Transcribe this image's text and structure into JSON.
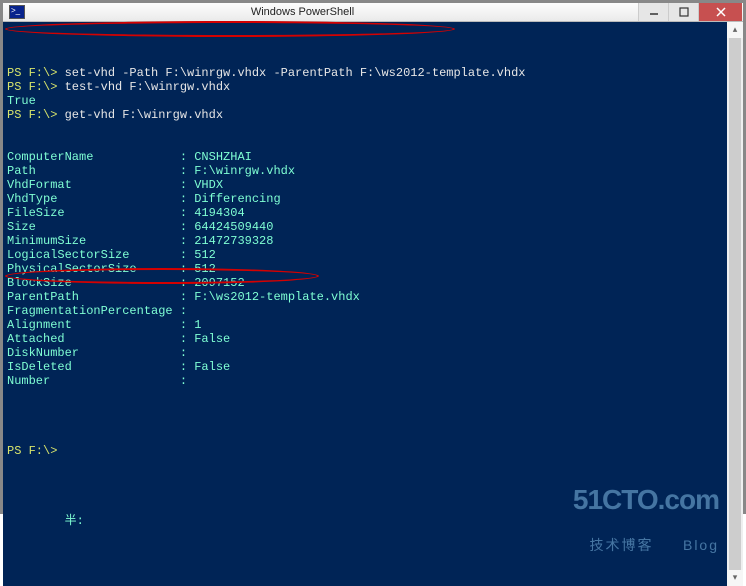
{
  "window": {
    "title": "Windows PowerShell"
  },
  "commands": {
    "prompt": "PS F:\\> ",
    "cmd1": "set-vhd -Path F:\\winrgw.vhdx -ParentPath F:\\ws2012-template.vhdx",
    "cmd2": "test-vhd F:\\winrgw.vhdx",
    "result2": "True",
    "cmd3": "get-vhd F:\\winrgw.vhdx",
    "final_prompt": "PS F:\\> ",
    "cursor_line": "        半:"
  },
  "vhd": [
    {
      "k": "ComputerName",
      "v": "CNSHZHAI"
    },
    {
      "k": "Path",
      "v": "F:\\winrgw.vhdx"
    },
    {
      "k": "VhdFormat",
      "v": "VHDX"
    },
    {
      "k": "VhdType",
      "v": "Differencing"
    },
    {
      "k": "FileSize",
      "v": "4194304"
    },
    {
      "k": "Size",
      "v": "64424509440"
    },
    {
      "k": "MinimumSize",
      "v": "21472739328"
    },
    {
      "k": "LogicalSectorSize",
      "v": "512"
    },
    {
      "k": "PhysicalSectorSize",
      "v": "512"
    },
    {
      "k": "BlockSize",
      "v": "2097152"
    },
    {
      "k": "ParentPath",
      "v": "F:\\ws2012-template.vhdx"
    },
    {
      "k": "FragmentationPercentage",
      "v": ""
    },
    {
      "k": "Alignment",
      "v": "1"
    },
    {
      "k": "Attached",
      "v": "False"
    },
    {
      "k": "DiskNumber",
      "v": ""
    },
    {
      "k": "IsDeleted",
      "v": "False"
    },
    {
      "k": "Number",
      "v": ""
    }
  ],
  "watermark": {
    "line1": "51CTO.com",
    "line2": "技术博客     Blog"
  }
}
